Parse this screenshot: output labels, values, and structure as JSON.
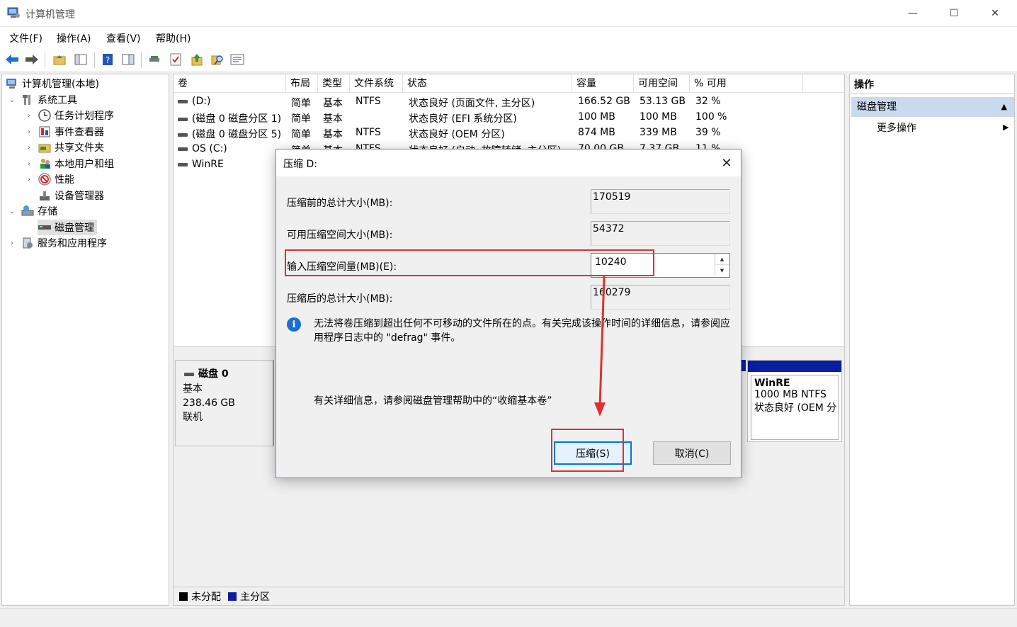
{
  "window": {
    "title": "计算机管理",
    "controls": {
      "minimize": "—",
      "maximize": "☐",
      "close": "✕"
    }
  },
  "menu": [
    "文件(F)",
    "操作(A)",
    "查看(V)",
    "帮助(H)"
  ],
  "toolbar_icons": [
    "back-icon",
    "forward-icon",
    "up-folder-icon",
    "show-hide-tree-icon",
    "help-icon",
    "console-icon",
    "connect-icon",
    "check-icon",
    "export-icon",
    "search-icon",
    "properties-icon"
  ],
  "tree": {
    "root": "计算机管理(本地)",
    "system_tools": "系统工具",
    "task_scheduler": "任务计划程序",
    "event_viewer": "事件查看器",
    "shared_folders": "共享文件夹",
    "local_users": "本地用户和组",
    "performance": "性能",
    "device_manager": "设备管理器",
    "storage": "存储",
    "disk_management": "磁盘管理",
    "services_apps": "服务和应用程序"
  },
  "volume_table": {
    "headers": [
      "卷",
      "布局",
      "类型",
      "文件系统",
      "状态",
      "容量",
      "可用空间",
      "% 可用"
    ],
    "rows": [
      [
        "(D:)",
        "简单",
        "基本",
        "NTFS",
        "状态良好 (页面文件, 主分区)",
        "166.52 GB",
        "53.13 GB",
        "32 %"
      ],
      [
        "(磁盘 0 磁盘分区 1)",
        "简单",
        "基本",
        "",
        "状态良好 (EFI 系统分区)",
        "100 MB",
        "100 MB",
        "100 %"
      ],
      [
        "(磁盘 0 磁盘分区 5)",
        "简单",
        "基本",
        "NTFS",
        "状态良好 (OEM 分区)",
        "874 MB",
        "339 MB",
        "39 %"
      ],
      [
        "OS (C:)",
        "简单",
        "基本",
        "NTFS",
        "状态良好 (启动, 故障转储, 主分区)",
        "70.00 GB",
        "7.37 GB",
        "11 %"
      ],
      [
        "WinRE",
        "",
        "",
        "",
        "",
        "",
        "",
        ""
      ]
    ]
  },
  "disk": {
    "name": "磁盘 0",
    "type": "基本",
    "size": "238.46 GB",
    "status": "联机"
  },
  "winre_partition": {
    "name": "WinRE",
    "size_fs": "1000 MB NTFS",
    "status": "状态良好 (OEM 分"
  },
  "legend": {
    "unallocated": "未分配",
    "primary": "主分区",
    "unallocated_color": "#000000",
    "primary_color": "#0b1ea0"
  },
  "actions": {
    "title": "操作",
    "section": "磁盘管理",
    "more": "更多操作"
  },
  "dialog": {
    "title": "压缩 D:",
    "total_before_label": "压缩前的总计大小(MB):",
    "total_before_value": "170519",
    "available_label": "可用压缩空间大小(MB):",
    "available_value": "54372",
    "input_label": "输入压缩空间量(MB)(E):",
    "input_value": "10240",
    "total_after_label": "压缩后的总计大小(MB):",
    "total_after_value": "160279",
    "info_text": "无法将卷压缩到超出任何不可移动的文件所在的点。有关完成该操作时间的详细信息，请参阅应用程序日志中的 \"defrag\" 事件。",
    "help_text": "有关详细信息，请参阅磁盘管理帮助中的“收缩基本卷”",
    "shrink_button": "压缩(S)",
    "cancel_button": "取消(C)"
  },
  "annotation_color": "#e03131"
}
